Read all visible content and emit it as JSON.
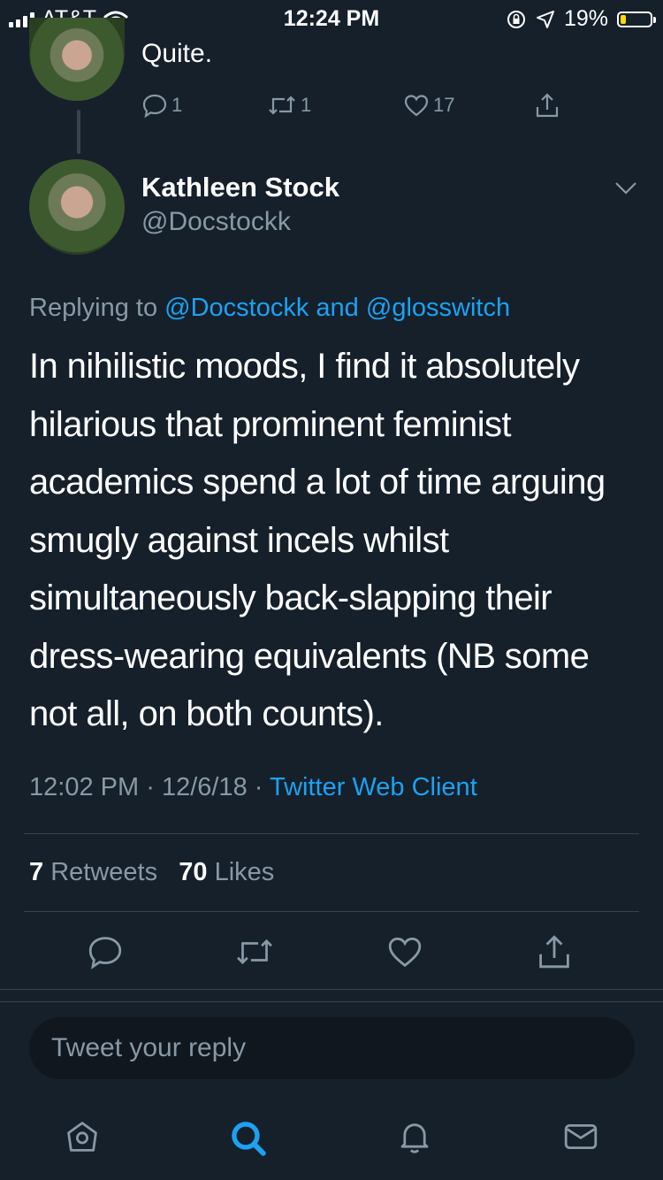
{
  "status_bar": {
    "carrier": "AT&T",
    "time": "12:24 PM",
    "battery": "19%",
    "battery_level": 0.19
  },
  "parent_tweet": {
    "text": "Quite.",
    "reply_count": "1",
    "retweet_count": "1",
    "like_count": "17"
  },
  "tweet": {
    "name": "Kathleen Stock",
    "handle": "@Docstockk",
    "replying_prefix": "Replying to",
    "replying_user1": "@Docstockk",
    "replying_and": "and",
    "replying_user2": "@glosswitch",
    "text": "In nihilistic moods, I find it absolutely hilarious that prominent feminist academics spend a lot of time arguing smugly against incels whilst simultaneously back-slapping their dress-wearing equivalents (NB some not all, on both counts).",
    "time": "12:02 PM",
    "date": "12/6/18",
    "separator": "·",
    "client": "Twitter Web Client",
    "retweets": "7",
    "retweets_label": "Retweets",
    "likes": "70",
    "likes_label": "Likes"
  },
  "reply_box": {
    "placeholder": "Tweet your reply"
  },
  "icons": {
    "accent": "#1da1f2",
    "muted": "#8899a6"
  }
}
